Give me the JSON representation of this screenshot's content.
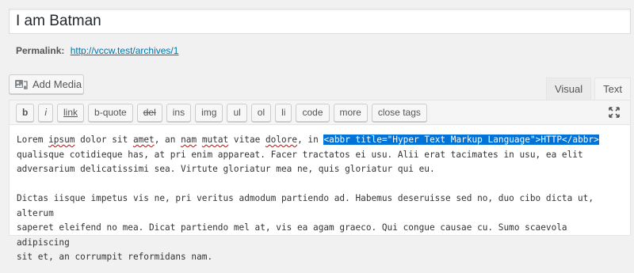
{
  "post": {
    "title": "I am Batman",
    "permalink_label": "Permalink:",
    "permalink_url": "http://vccw.test/archives/1"
  },
  "media": {
    "add_media_label": "Add Media",
    "icon": "media-icon"
  },
  "tabs": [
    {
      "label": "Visual",
      "active": false
    },
    {
      "label": "Text",
      "active": true
    }
  ],
  "toolbar": {
    "buttons": [
      "b",
      "i",
      "link",
      "b-quote",
      "del",
      "ins",
      "img",
      "ul",
      "ol",
      "li",
      "code",
      "more",
      "close tags"
    ],
    "fullscreen_icon": "fullscreen-icon"
  },
  "content": {
    "p1_a": "Lorem ",
    "p1_b": "ipsum",
    "p1_c": " dolor sit ",
    "p1_d": "amet",
    "p1_e": ", an ",
    "p1_f": "nam",
    "p1_g": " ",
    "p1_h": "mutat",
    "p1_i": " vitae ",
    "p1_j": "dolore",
    "p1_k": ", in ",
    "selected": "<abbr title=\"Hyper Text Markup Language\">HTTP</abbr>",
    "line2": "qualisque cotidieque has, at pri enim appareat. Facer tractatos ei usu. Alii erat tacimates in usu, ea elit",
    "line3": "adversarium delicatissimi sea. Virtute gloriatur mea ne, quis gloriatur qui eu.",
    "line5": "Dictas iisque impetus vis ne, pri veritus admodum partiendo ad. Habemus deseruisse sed no, duo cibo dicta ut, alterum",
    "line6": "saperet eleifend no mea. Dicat partiendo mel at, vis ea agam graeco. Qui congue causae cu. Sumo scaevola adipiscing",
    "line7": "sit et, an corrumpit reformidans nam."
  },
  "colors": {
    "link": "#0073aa",
    "selection": "#0073d9",
    "spellcheck": "#dd0000"
  }
}
